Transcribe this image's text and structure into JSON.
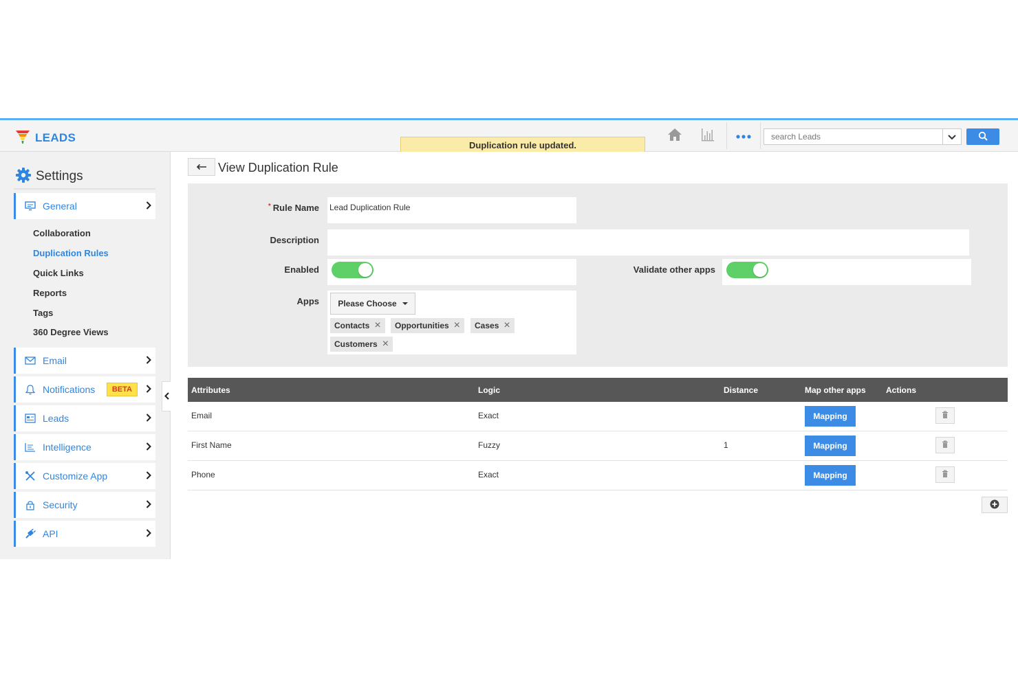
{
  "header": {
    "brand": "LEADS",
    "toast": "Duplication rule updated.",
    "search_placeholder": "search Leads"
  },
  "sidebar": {
    "title": "Settings",
    "general": {
      "label": "General"
    },
    "sub_items": [
      "Collaboration",
      "Duplication Rules",
      "Quick Links",
      "Reports",
      "Tags",
      "360 Degree Views"
    ],
    "active_sub": "Duplication Rules",
    "nav": [
      {
        "label": "Email",
        "icon": "envelope-icon"
      },
      {
        "label": "Notifications",
        "icon": "bell-icon",
        "badge": "BETA"
      },
      {
        "label": "Leads",
        "icon": "leads-app-icon"
      },
      {
        "label": "Intelligence",
        "icon": "intelligence-icon"
      },
      {
        "label": "Customize App",
        "icon": "tools-icon"
      },
      {
        "label": "Security",
        "icon": "lock-icon"
      },
      {
        "label": "API",
        "icon": "plug-icon"
      }
    ]
  },
  "page": {
    "title": "View Duplication Rule"
  },
  "form": {
    "rule_name_label": "Rule Name",
    "rule_name_value": "Lead Duplication Rule",
    "description_label": "Description",
    "description_value": "",
    "enabled_label": "Enabled",
    "enabled": true,
    "validate_label": "Validate other apps",
    "validate": true,
    "apps_label": "Apps",
    "apps_choose": "Please Choose",
    "apps_tags": [
      "Contacts",
      "Opportunities",
      "Cases",
      "Customers"
    ]
  },
  "table": {
    "headers": [
      "Attributes",
      "Logic",
      "Distance",
      "Map other apps",
      "Actions"
    ],
    "rows": [
      {
        "attribute": "Email",
        "logic": "Exact",
        "distance": "",
        "map": "Mapping"
      },
      {
        "attribute": "First Name",
        "logic": "Fuzzy",
        "distance": "1",
        "map": "Mapping"
      },
      {
        "attribute": "Phone",
        "logic": "Exact",
        "distance": "",
        "map": "Mapping"
      }
    ]
  },
  "colors": {
    "accent": "#3c8ce6",
    "toggle_on": "#5fd067",
    "toast_bg": "#fbeba8",
    "table_header": "#575757",
    "beta_bg": "#ffe148"
  }
}
